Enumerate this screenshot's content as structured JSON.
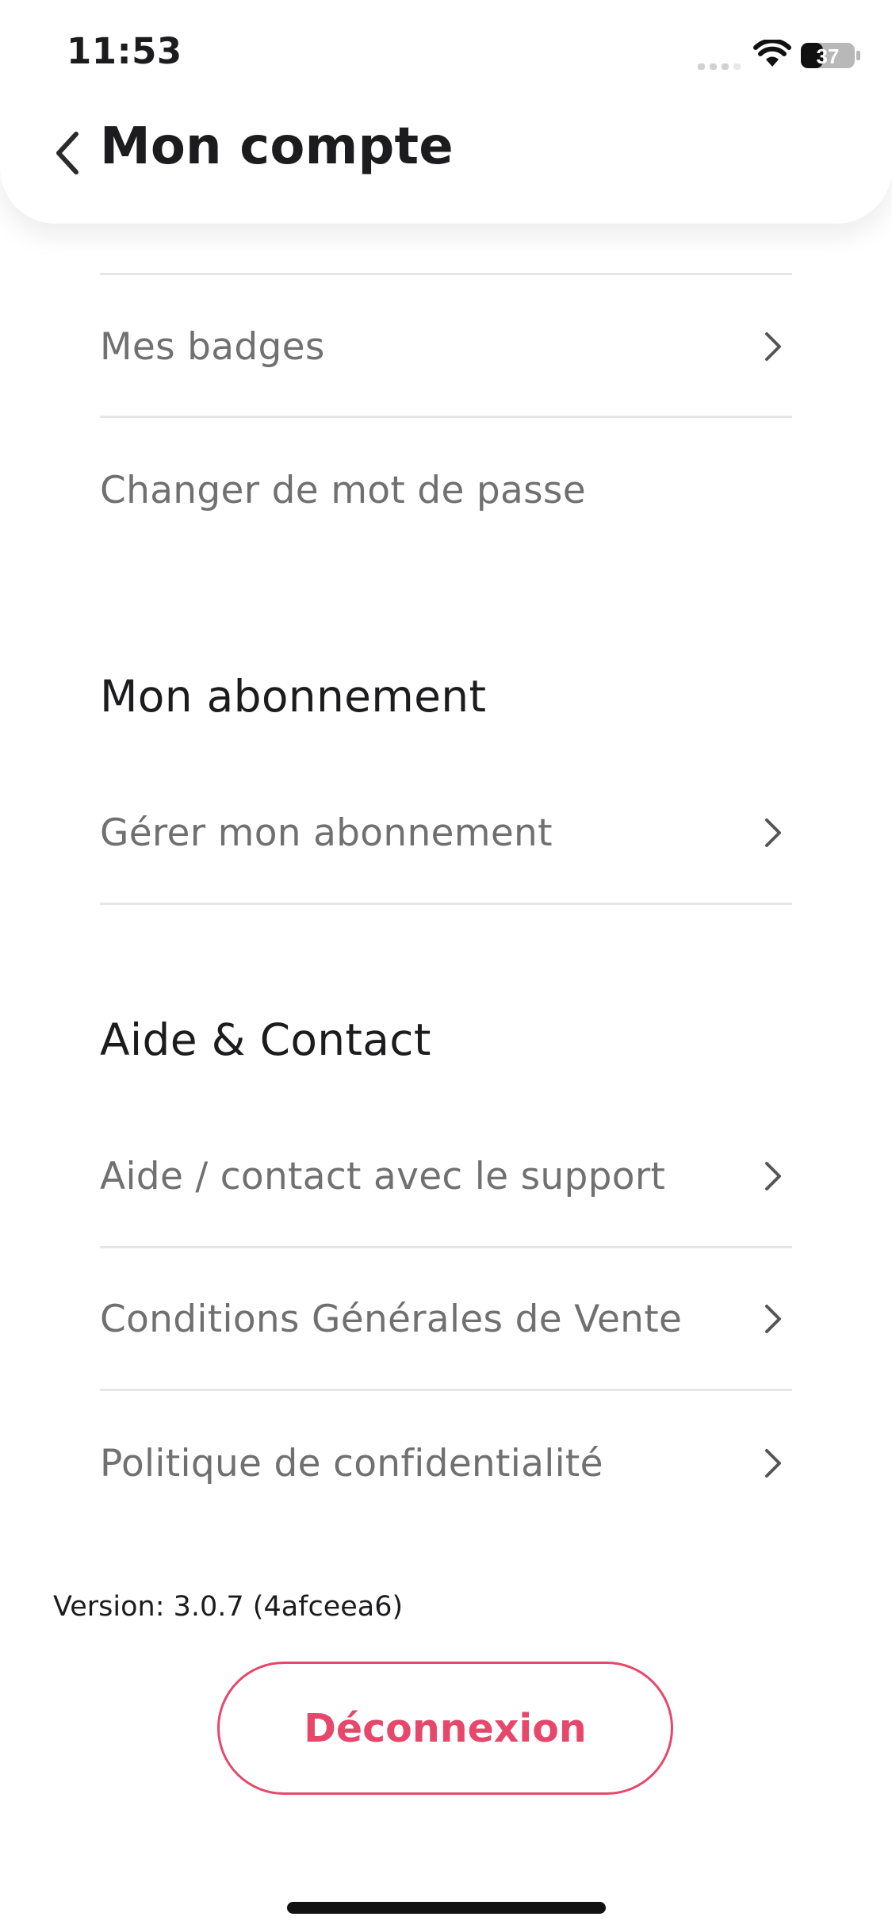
{
  "status_bar": {
    "time": "11:53",
    "battery_level": "37"
  },
  "header": {
    "title": "Mon compte"
  },
  "account_items": [
    {
      "label": "Mes badges"
    },
    {
      "label": "Changer de mot de passe"
    }
  ],
  "subscription": {
    "title": "Mon abonnement",
    "items": [
      {
        "label": "Gérer mon abonnement"
      }
    ]
  },
  "help": {
    "title": "Aide & Contact",
    "items": [
      {
        "label": "Aide / contact avec le support"
      },
      {
        "label": "Conditions Générales de Vente"
      },
      {
        "label": "Politique de confidentialité"
      }
    ]
  },
  "footer": {
    "version": "Version: 3.0.7 (4afceea6)",
    "logout_label": "Déconnexion"
  },
  "colors": {
    "accent": "#e6476a",
    "row_text": "#707070",
    "title_text": "#1c1c1e",
    "divider": "#e6e6e6"
  },
  "icons": {
    "back": "chevron-left-icon",
    "row": "chevron-right-icon",
    "wifi": "wifi-icon",
    "signal": "cellular-signal-icon",
    "battery": "battery-icon"
  }
}
